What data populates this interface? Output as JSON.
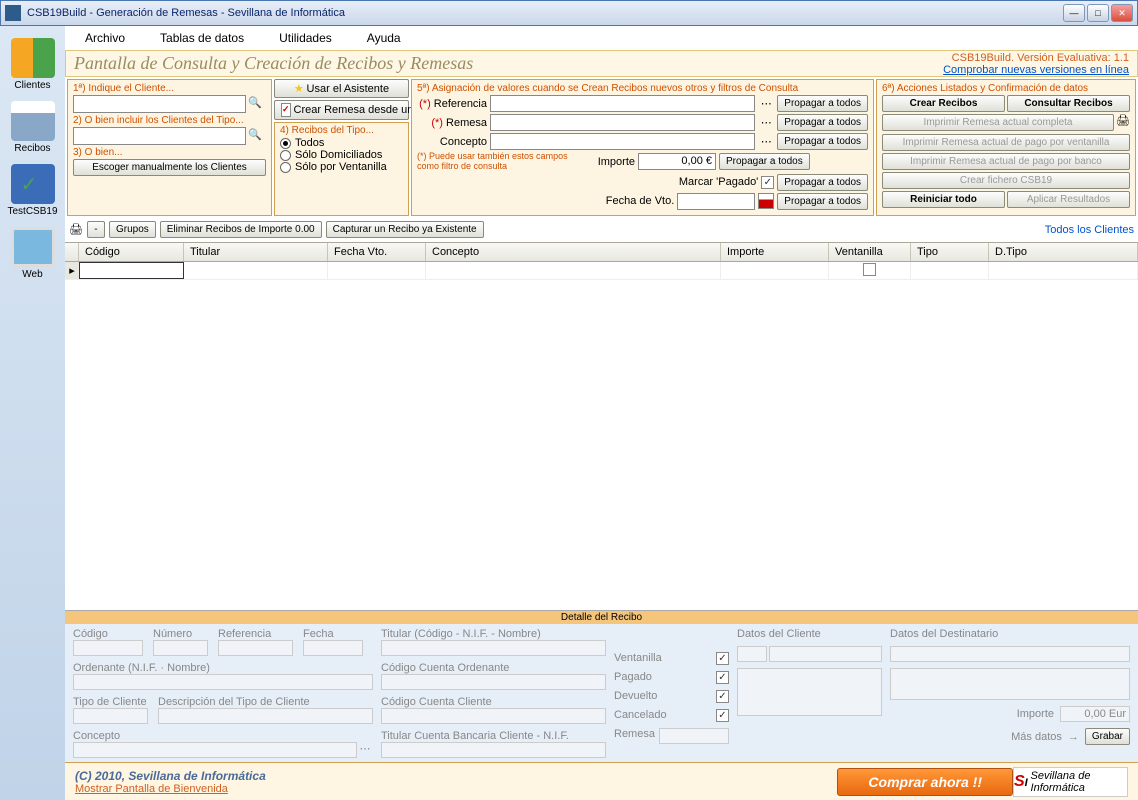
{
  "title": "CSB19Build - Generación de Remesas - Sevillana de Informática",
  "menu": {
    "archivo": "Archivo",
    "tablas": "Tablas de datos",
    "utilidades": "Utilidades",
    "ayuda": "Ayuda"
  },
  "leftbar": {
    "clientes": "Clientes",
    "recibos": "Recibos",
    "testcsb": "TestCSB19",
    "web": "Web"
  },
  "header": {
    "title": "Pantalla de Consulta y Creación de Recibos y Remesas",
    "version": "CSB19Build. Versión Evaluativa:  1.1",
    "check": "Comprobar nuevas versiones en línea"
  },
  "pa": {
    "l1": "1ª) Indique el Cliente...",
    "l2": "2) O bien incluir los Clientes del Tipo...",
    "l3": "3) O bien...",
    "btn": "Escoger manualmente los Clientes"
  },
  "pb": {
    "asist": "Usar el Asistente",
    "csv": "Crear Remesa desde un fichero .csv",
    "l4": "4) Recibos del Tipo...",
    "r1": "Todos",
    "r2": "Sólo Domiciliados",
    "r3": "Sólo por Ventanilla"
  },
  "pc": {
    "title": "5ª) Asignación de valores cuando se Crean Recibos nuevos otros y filtros de Consulta",
    "ref": "Referencia",
    "rem": "Remesa",
    "con": "Concepto",
    "imp": "Importe",
    "impv": "0,00 €",
    "mark": "Marcar 'Pagado'",
    "fv": "Fecha de Vto.",
    "note": "(*) Puede usar también estos campos como filtro de consulta",
    "prop": "Propagar a todos"
  },
  "pd": {
    "title": "6ª) Acciones Listados y Confirmación de datos",
    "b1": "Crear Recibos",
    "b2": "Consultar Recibos",
    "b3": "Imprimir Remesa actual completa",
    "b4": "Imprimir Remesa actual de pago por ventanilla",
    "b5": "Imprimir Remesa actual de pago por banco",
    "b6": "Crear fichero CSB19",
    "b7": "Reiniciar todo",
    "b8": "Aplicar Resultados"
  },
  "tb2": {
    "grupos": "Grupos",
    "elim": "Eliminar Recibos de Importe 0.00",
    "capt": "Capturar un Recibo ya Existente",
    "todos": "Todos los Clientes"
  },
  "grid": {
    "codigo": "Código",
    "titular": "Titular",
    "fecha": "Fecha Vto.",
    "concepto": "Concepto",
    "importe": "Importe",
    "vent": "Ventanilla",
    "tipo": "Tipo",
    "dtipo": "D.Tipo"
  },
  "detail": {
    "title": "Detalle del Recibo",
    "codigo": "Código",
    "numero": "Número",
    "ref": "Referencia",
    "fecha": "Fecha",
    "ord": "Ordenante (N.I.F. · Nombre)",
    "tipo": "Tipo de Cliente",
    "desc": "Descripción del Tipo de Cliente",
    "con": "Concepto",
    "tit": "Titular (Código - N.I.F. - Nombre)",
    "cco": "Código Cuenta Ordenante",
    "ccc": "Código Cuenta Cliente",
    "tcb": "Titular Cuenta Bancaria Cliente - N.I.F.",
    "vent": "Ventanilla",
    "pag": "Pagado",
    "dev": "Devuelto",
    "can": "Cancelado",
    "rem": "Remesa",
    "dc": "Datos del Cliente",
    "dd": "Datos del Destinatario",
    "imp": "Importe",
    "impv": "0,00 Eur",
    "mas": "Más datos",
    "grab": "Grabar"
  },
  "footer": {
    "copy": "(C) 2010, Sevillana de Informática",
    "welcome": "Mostrar Pantalla de Bienvenida",
    "buy": "Comprar ahora !!",
    "logo": "Sevillana de Informática"
  }
}
